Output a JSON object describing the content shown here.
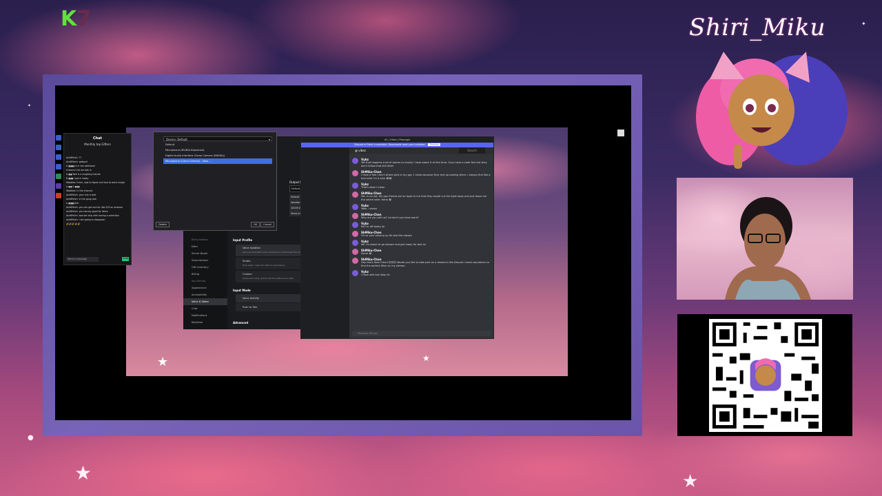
{
  "overlay": {
    "corner_logo_k": "K",
    "corner_logo_num": "7",
    "streamer_name": "Shiri_Miku"
  },
  "chat_panel": {
    "title": "Chat",
    "subtitle": "Monthly top Gifters",
    "messages": [
      "Ash6Fetch: ??",
      "Ash6Fetch: webpull",
      "A ▮▮▮▮▮ is in the bathroom",
      "it doesn't let me talk in",
      "A ▮▮▮ Beti is a roughing minute",
      "B ▮▮▮▮ I got in today",
      "Wobbles: hmm, now to figure out how to work emojis",
      "A ▮▮▮ it ▮▮▮▮",
      "Wobbles: in the channel",
      "Ash6Fetch: your mic is bad",
      "Ash6Fetch: in the gang lock",
      "A ▮▮▮▮▮ brb",
      "Ash6Fetch: you can get one for like $15 on amazon",
      "Ash6Fetch: you harvey good for items",
      "Ash6Fetch: bad set ship with having a collection",
      "Ash6Fetch: I am going to disappear",
      "🎉🎉🎉 🎉🎉"
    ],
    "input_placeholder": "Send a message",
    "chat_button": "Chat"
  },
  "mic_dialog": {
    "dropdown_value": "Default",
    "dropdown_label": "Device:",
    "options": [
      "Default",
      "Microphone (NVIDIA Broadcast)",
      "Digital Audio Interface (Camo Camera (NVIDIA))",
      "Microphone (Camo Camera) - New ..."
    ],
    "selected_index": 3,
    "details_button": "Details",
    "ok_button": "OK",
    "cancel_button": "Cancel"
  },
  "settings": {
    "sidebar": [
      {
        "label": "Billing Settings",
        "header": true
      },
      {
        "label": "Nitro"
      },
      {
        "label": "Server Boost"
      },
      {
        "label": "Subscriptions"
      },
      {
        "label": "Gift Inventory"
      },
      {
        "label": "Billing"
      },
      {
        "label": "App Settings",
        "header": true
      },
      {
        "label": "Appearance"
      },
      {
        "label": "Accessibility"
      },
      {
        "label": "Voice & Video",
        "active": true
      },
      {
        "label": "Chat"
      },
      {
        "label": "Notifications"
      },
      {
        "label": "Keybinds"
      }
    ],
    "input_profile_label": "Input Profile",
    "profiles": [
      {
        "title": "Voice Isolation",
        "desc": "Just your beautiful voice: let Discord cut through the noise"
      },
      {
        "title": "Studio",
        "desc": "Pure audio: open mic with no processing"
      },
      {
        "title": "Custom",
        "desc": "Advanced mode: gimme all the buttons and dials"
      }
    ],
    "input_mode_label": "Input Mode",
    "modes": [
      "Voice Activity",
      "Push to Talk"
    ],
    "advanced_label": "Advanced",
    "output_device_label": "Output Device",
    "output_device_value": "Default, Speakers (Razer Leviathan...",
    "output_menu": [
      "Default",
      "Speakers (Razer Leviathan V2 X)",
      "32K39 (NVIDIA High Definition Audio)",
      "Show more..."
    ]
  },
  "discord": {
    "window_title": "#1 | Vibez | Ptwangle",
    "banner_text": "Discord in Flash is available. Downloads have your invitation",
    "banner_button": "Dismiss",
    "channel_name": "vibez",
    "search_placeholder": "Search",
    "messages": [
      {
        "author": "Vybz",
        "text": "Yes that happens a lot of places to mainly i have about it all the time. Guys have a code fine but they don't follow that still other"
      },
      {
        "author": "ShMiku-Chan",
        "text": "I have a few i don't where girls in my gay 1 kinds because they end up looking them. I always find like a kind who i'm a pine 😂😂"
      },
      {
        "author": "Vybz",
        "text": "That's what I mean"
      },
      {
        "author": "ShMiku-Chan",
        "text": "Yes. Is no out. My gay friends are so loyal to me that they would cut the light away and just leave me the where later. Haha 😂"
      },
      {
        "author": "Vybz",
        "text": "Yeah, i mean"
      },
      {
        "author": "ShMiku-Chan",
        "text": "Why are you still up? Lol don't you have work?"
      },
      {
        "author": "Vybz",
        "text": "No I'm off today lol"
      },
      {
        "author": "ShMiku-Chan",
        "text": "Oh so your staying up till late like always"
      },
      {
        "author": "Vybz",
        "text": "Idk I'm about to go shower and get ready for bed lol"
      },
      {
        "author": "ShMiku-Chan",
        "text": "Same 😂"
      },
      {
        "author": "ShMiku-Chan",
        "text": "Hey there dear friend 😊😊😊 Would you like to take part on a research this Discord I need volunteers to find the perfect filter on my stream."
      },
      {
        "author": "Vybz",
        "text": "I have wild but okay lol"
      }
    ],
    "input_placeholder": "Message @Vybz"
  }
}
